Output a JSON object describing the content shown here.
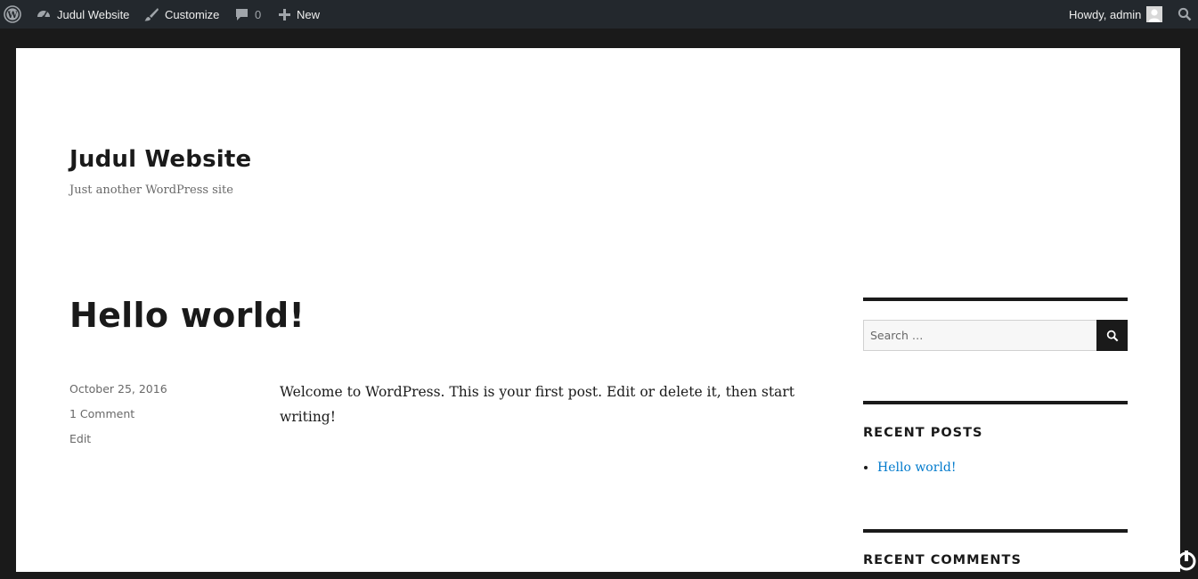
{
  "admin_bar": {
    "wp_logo": "wordpress-logo-icon",
    "site_name": "Judul Website",
    "customize": "Customize",
    "comments_count": "0",
    "new_label": "New",
    "howdy": "Howdy, admin",
    "bg_color": "#23282d"
  },
  "site": {
    "title": "Judul Website",
    "description": "Just another WordPress site"
  },
  "post": {
    "title": "Hello world!",
    "date": "October 25, 2016",
    "comments": "1 Comment",
    "edit": "Edit",
    "content": "Welcome to WordPress. This is your first post. Edit or delete it, then start writing!"
  },
  "sidebar": {
    "search_placeholder": "Search …",
    "recent_posts_title": "Recent Posts",
    "recent_posts": [
      "Hello world!"
    ],
    "recent_comments_title": "Recent Comments",
    "link_color": "#007acc"
  }
}
